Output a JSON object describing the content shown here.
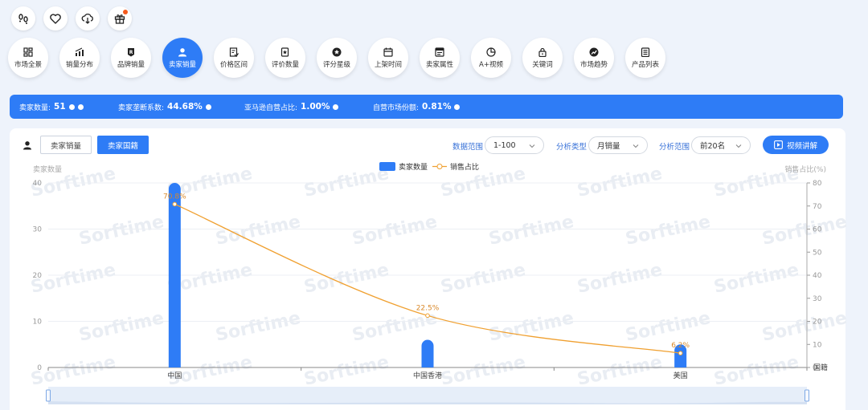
{
  "top_icons": [
    "footprints-icon",
    "heart-icon",
    "cloud-download-icon",
    "gift-icon"
  ],
  "nav": [
    {
      "label": "市场全景",
      "icon": "grid-icon"
    },
    {
      "label": "销量分布",
      "icon": "bar-chart-icon"
    },
    {
      "label": "品牌销量",
      "icon": "brand-icon"
    },
    {
      "label": "卖家销量",
      "icon": "seller-icon",
      "active": true
    },
    {
      "label": "价格区间",
      "icon": "price-icon"
    },
    {
      "label": "评价数量",
      "icon": "review-icon"
    },
    {
      "label": "评分星级",
      "icon": "star-icon"
    },
    {
      "label": "上架时间",
      "icon": "calendar-icon"
    },
    {
      "label": "卖家属性",
      "icon": "attribute-icon"
    },
    {
      "label": "A+视频",
      "icon": "video-icon"
    },
    {
      "label": "关键词",
      "icon": "lock-icon"
    },
    {
      "label": "市场趋势",
      "icon": "trend-icon"
    },
    {
      "label": "产品列表",
      "icon": "list-icon"
    }
  ],
  "stats": {
    "seller_count_label": "卖家数量:",
    "seller_count_value": "51",
    "monopoly_label": "卖家垄断系数:",
    "monopoly_value": "44.68%",
    "amazon_label": "亚马逊自营占比:",
    "amazon_value": "1.00%",
    "self_label": "自营市场份额:",
    "self_value": "0.81%"
  },
  "toolbar": {
    "tab_sales": "卖家销量",
    "tab_nationality": "卖家国籍",
    "data_range_label": "数据范围",
    "data_range_value": "1-100",
    "analysis_type_label": "分析类型",
    "analysis_type_value": "月销量",
    "analysis_range_label": "分析范围",
    "analysis_range_value": "前20名",
    "video_button": "视频讲解"
  },
  "watermark": "Sorftime",
  "colors": {
    "accent": "#2e7cf6",
    "line": "#f0a030",
    "label": "#d9892a"
  },
  "chart_data": {
    "type": "bar",
    "categories": [
      "中国",
      "中国香港",
      "美国"
    ],
    "series": [
      {
        "name": "卖家数量",
        "type": "bar",
        "axis": "left",
        "values": [
          40,
          6,
          5
        ]
      },
      {
        "name": "销售占比",
        "type": "line",
        "axis": "right",
        "values": [
          70.8,
          22.5,
          6.2
        ],
        "labels": [
          "70.8%",
          "22.5%",
          "6.2%"
        ]
      }
    ],
    "ylabel": "卖家数量",
    "y2label": "销售占比(%)",
    "xlabel": "国籍",
    "ylim": [
      0,
      40
    ],
    "y2lim": [
      0,
      80
    ],
    "yticks": [
      "0",
      "10",
      "20",
      "30",
      "40"
    ],
    "y2ticks": [
      "0",
      "10",
      "20",
      "30",
      "40",
      "50",
      "60",
      "70",
      "80"
    ],
    "legend": "top-center",
    "grid": true
  }
}
